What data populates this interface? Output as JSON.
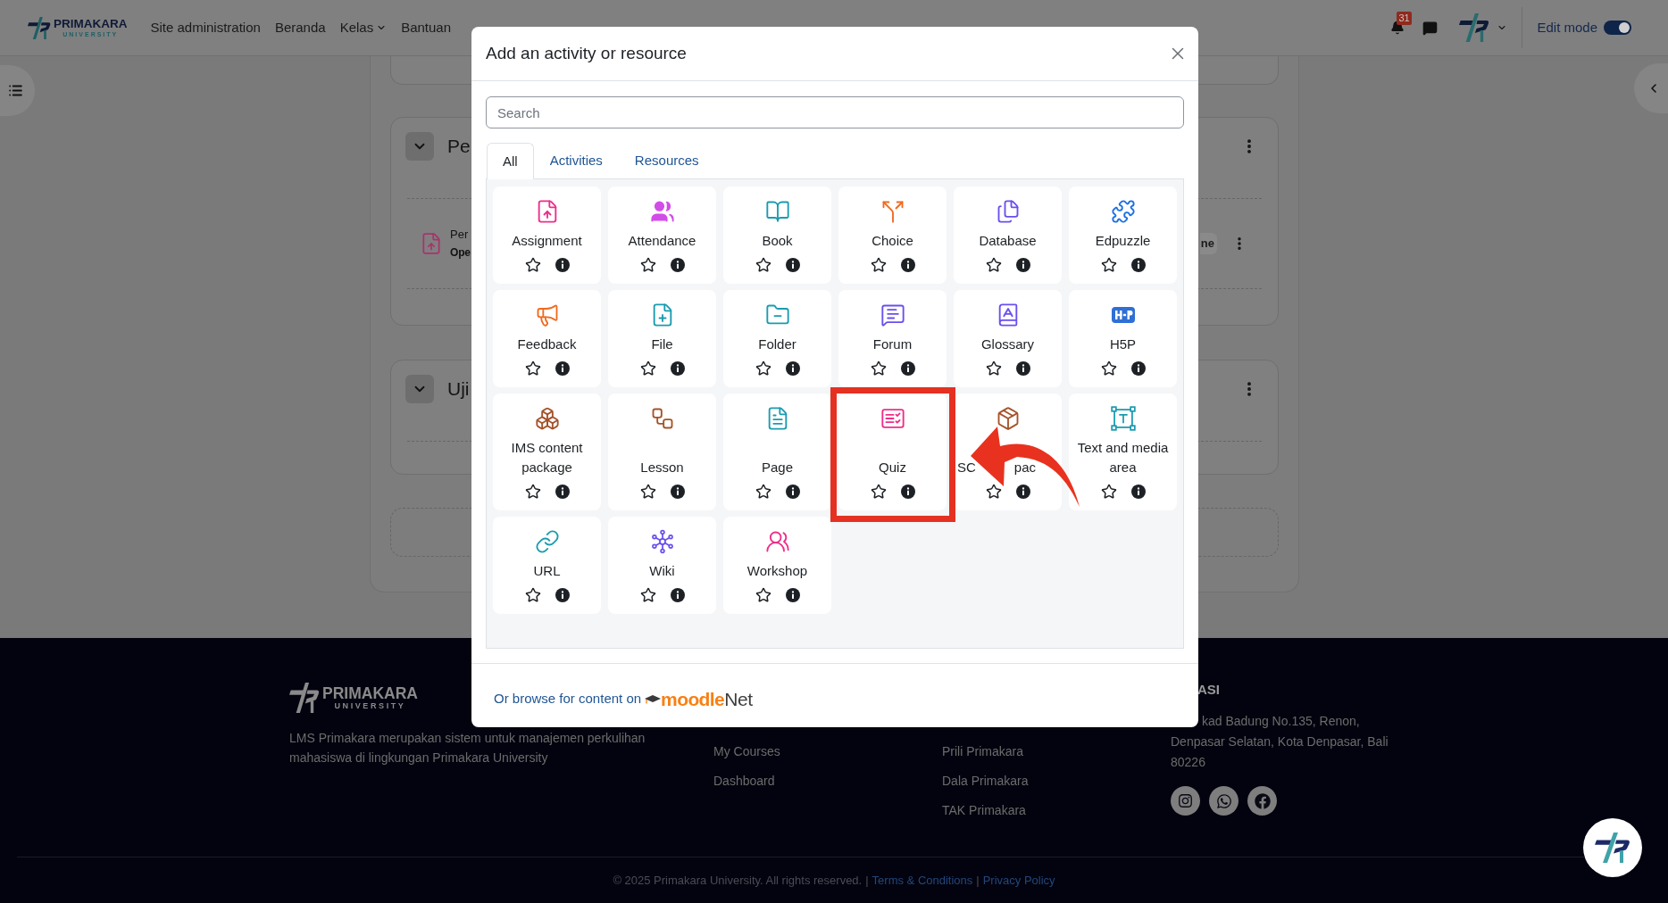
{
  "header": {
    "brand": {
      "name": "PRIMAKARA",
      "tagline": "UNIVERSITY"
    },
    "nav": [
      {
        "label": "Site administration",
        "dropdown": false
      },
      {
        "label": "Beranda",
        "dropdown": false
      },
      {
        "label": "Kelas",
        "dropdown": true
      },
      {
        "label": "Bantuan",
        "dropdown": false
      }
    ],
    "notifications": {
      "count": "31"
    },
    "edit_mode": {
      "label": "Edit mode",
      "on": true
    }
  },
  "course": {
    "sections": [
      {
        "title": "Pe",
        "expanded": true,
        "activities": [
          {
            "name": "Per",
            "detail": "Ope",
            "button": "ne"
          }
        ]
      },
      {
        "title": "Uji",
        "expanded": true
      }
    ]
  },
  "modal": {
    "title": "Add an activity or resource",
    "search": {
      "placeholder": "Search"
    },
    "tabs": [
      {
        "label": "All",
        "selected": true
      },
      {
        "label": "Activities",
        "selected": false
      },
      {
        "label": "Resources",
        "selected": false
      }
    ],
    "tiles": [
      {
        "label": "Assignment",
        "starred": false,
        "highlighted": false
      },
      {
        "label": "Attendance",
        "starred": false,
        "highlighted": false
      },
      {
        "label": "Book",
        "starred": false,
        "highlighted": false
      },
      {
        "label": "Choice",
        "starred": false,
        "highlighted": false
      },
      {
        "label": "Database",
        "starred": false,
        "highlighted": false
      },
      {
        "label": "Edpuzzle",
        "starred": false,
        "highlighted": false
      },
      {
        "label": "Feedback",
        "starred": false,
        "highlighted": false
      },
      {
        "label": "File",
        "starred": false,
        "highlighted": false
      },
      {
        "label": "Folder",
        "starred": false,
        "highlighted": false
      },
      {
        "label": "Forum",
        "starred": false,
        "highlighted": false
      },
      {
        "label": "Glossary",
        "starred": false,
        "highlighted": false
      },
      {
        "label": "H5P",
        "starred": false,
        "highlighted": false
      },
      {
        "label": "IMS content package",
        "starred": false,
        "highlighted": false
      },
      {
        "label": "Lesson",
        "starred": false,
        "highlighted": false
      },
      {
        "label": "Page",
        "starred": false,
        "highlighted": false
      },
      {
        "label": "Quiz",
        "starred": false,
        "highlighted": true
      },
      {
        "label": "SC",
        "label_tail": "pac",
        "starred": false,
        "highlighted": false
      },
      {
        "label": "Text and media area",
        "starred": false,
        "highlighted": false
      },
      {
        "label": "URL",
        "starred": false,
        "highlighted": false
      },
      {
        "label": "Wiki",
        "starred": false,
        "highlighted": false
      },
      {
        "label": "Workshop",
        "starred": false,
        "highlighted": false
      }
    ],
    "footer": {
      "text": "Or browse for content on",
      "logo": {
        "part_1": "moodle",
        "part_2": "Net"
      }
    }
  },
  "footer": {
    "brand": {
      "name": "PRIMAKARA",
      "tagline": "UNIVERSITY"
    },
    "description": "LMS Primakara merupakan sistem untuk manajemen perkulihan mahasiswa di lingkungan Primakara University",
    "links_1": [
      "My Courses",
      "Dashboard"
    ],
    "links_2": [
      "Prili Primakara",
      "Dala Primakara",
      "TAK Primakara"
    ],
    "contact": {
      "heading": "ASI",
      "address_lines": [
        "kad Badung No.135, Renon,",
        "Denpasar Selatan, Kota Denpasar, Bali",
        "80226"
      ]
    },
    "bottom_bar": [
      {
        "kind": "text",
        "text": "© 2025 Primakara University. All rights reserved."
      },
      {
        "kind": "separator",
        "text": "|"
      },
      {
        "kind": "link",
        "text": "Terms & Conditions"
      },
      {
        "kind": "separator",
        "text": "|"
      },
      {
        "kind": "link",
        "text": "Privacy Policy"
      }
    ]
  }
}
